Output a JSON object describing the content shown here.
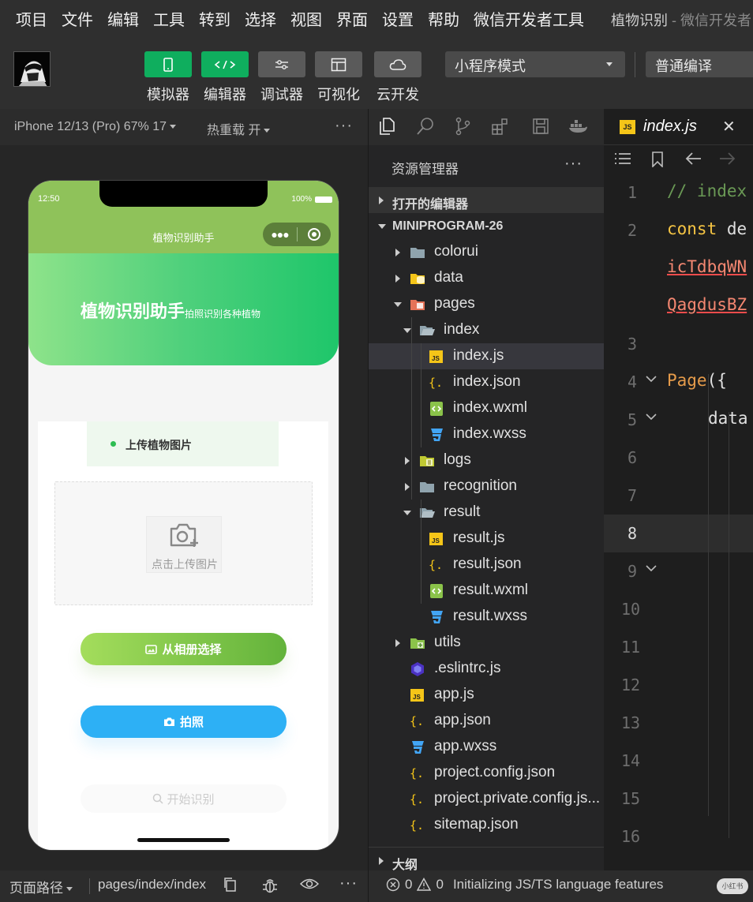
{
  "menubar": {
    "items": [
      "项目",
      "文件",
      "编辑",
      "工具",
      "转到",
      "选择",
      "视图",
      "界面",
      "设置",
      "帮助",
      "微信开发者工具"
    ],
    "window_title": "植物识别",
    "window_title_sub": " - 微信开发者"
  },
  "toolbar": {
    "buttons": [
      {
        "label": "模拟器",
        "icon": "phone-icon"
      },
      {
        "label": "编辑器",
        "icon": "code-icon"
      },
      {
        "label": "调试器",
        "icon": "debug-sliders-icon"
      },
      {
        "label": "可视化",
        "icon": "layout-icon"
      },
      {
        "label": "云开发",
        "icon": "cloud-icon"
      }
    ],
    "mode_select": "小程序模式",
    "compile_select": "普通编译"
  },
  "simulator": {
    "device": "iPhone 12/13 (Pro) 67% 17",
    "hot_reload": "热重载 开",
    "more": "···",
    "phone": {
      "time": "12:50",
      "battery": "100%",
      "nav_title": "植物识别助手",
      "hero_title": "植物识别助手",
      "hero_subtitle": "拍照识别各种植物",
      "upload_tab": "上传植物图片",
      "upload_hint": "点击上传图片",
      "btn_album": "从相册选择",
      "btn_photo": "拍照",
      "btn_start": "开始识别"
    },
    "footer": {
      "path_label": "页面路径",
      "path": "pages/index/index",
      "more": "···"
    }
  },
  "explorer": {
    "title": "资源管理器",
    "more": "···",
    "open_editors": "打开的编辑器",
    "project": "MINIPROGRAM-26",
    "outline": "大纲",
    "tree": [
      {
        "name": "colorui",
        "type": "folder"
      },
      {
        "name": "data",
        "type": "folder-data"
      },
      {
        "name": "pages",
        "type": "folder-pages"
      },
      {
        "name": "index",
        "type": "folder-open"
      },
      {
        "name": "index.js",
        "type": "js"
      },
      {
        "name": "index.json",
        "type": "json"
      },
      {
        "name": "index.wxml",
        "type": "wxml"
      },
      {
        "name": "index.wxss",
        "type": "wxss"
      },
      {
        "name": "logs",
        "type": "folder-logs"
      },
      {
        "name": "recognition",
        "type": "folder"
      },
      {
        "name": "result",
        "type": "folder-open"
      },
      {
        "name": "result.js",
        "type": "js"
      },
      {
        "name": "result.json",
        "type": "json"
      },
      {
        "name": "result.wxml",
        "type": "wxml"
      },
      {
        "name": "result.wxss",
        "type": "wxss"
      },
      {
        "name": "utils",
        "type": "folder-utils"
      },
      {
        "name": ".eslintrc.js",
        "type": "eslint"
      },
      {
        "name": "app.js",
        "type": "js"
      },
      {
        "name": "app.json",
        "type": "json"
      },
      {
        "name": "app.wxss",
        "type": "wxss"
      },
      {
        "name": "project.config.json",
        "type": "json"
      },
      {
        "name": "project.private.config.js...",
        "type": "json"
      },
      {
        "name": "sitemap.json",
        "type": "json"
      }
    ]
  },
  "editor": {
    "tab_name": "index.js",
    "tab_close": "✕",
    "lines": [
      {
        "num": "1",
        "text": "// index"
      },
      {
        "num": "2",
        "text_kw": "const",
        "text": " de"
      },
      {
        "num": "",
        "text": "icTdbqWN"
      },
      {
        "num": "",
        "text": "QagdusBZ"
      },
      {
        "num": "3",
        "text": ""
      },
      {
        "num": "4",
        "text_call": "Page",
        "text": "({"
      },
      {
        "num": "5",
        "text": "data"
      },
      {
        "num": "6",
        "text": ""
      },
      {
        "num": "7",
        "text": ""
      },
      {
        "num": "8",
        "text": ""
      },
      {
        "num": "9",
        "text": ""
      },
      {
        "num": "10",
        "text": ""
      },
      {
        "num": "11",
        "text": ""
      },
      {
        "num": "12",
        "text": ""
      },
      {
        "num": "13",
        "text": ""
      },
      {
        "num": "14",
        "text": ""
      },
      {
        "num": "15",
        "text": ""
      },
      {
        "num": "16",
        "text": ""
      }
    ]
  },
  "statusbar": {
    "errors": "0",
    "warnings": "0",
    "message": "Initializing JS/TS language features",
    "watermark": "小红书"
  },
  "colors": {
    "accent_green": "#0fae5e",
    "hero_green": "#4fd07c",
    "photo_blue": "#2db0f5"
  }
}
